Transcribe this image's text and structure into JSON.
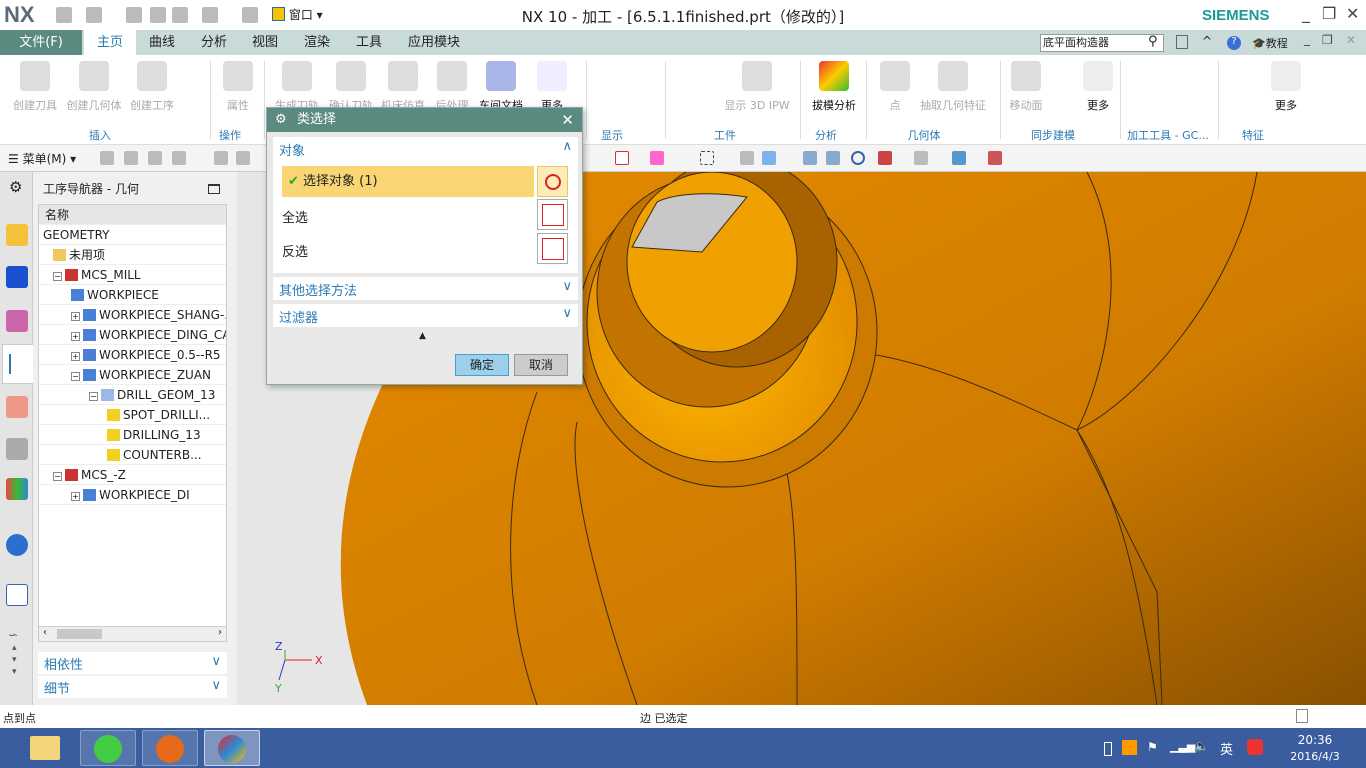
{
  "title_bar": {
    "logo": "NX",
    "window_title": "NX 10 - 加工 - [6.5.1.1finished.prt（修改的）]",
    "window_menu": "窗口",
    "brand": "SIEMENS"
  },
  "menu_tabs": {
    "file": "文件(F)",
    "tabs": [
      "主页",
      "曲线",
      "分析",
      "视图",
      "渲染",
      "工具",
      "应用模块"
    ],
    "active": "主页"
  },
  "search": {
    "value": "底平面构造器",
    "tutorial": "教程"
  },
  "ribbon": {
    "buttons": [
      {
        "label": "创建刀具",
        "enabled": false
      },
      {
        "label": "创建几何体",
        "enabled": false
      },
      {
        "label": "创建工序",
        "enabled": false
      },
      {
        "label": "属性",
        "enabled": false
      },
      {
        "label": "生成刀轨",
        "enabled": false
      },
      {
        "label": "确认刀轨",
        "enabled": false
      },
      {
        "label": "机床仿真",
        "enabled": false
      },
      {
        "label": "后处理",
        "enabled": false
      },
      {
        "label": "车间文档",
        "enabled": true
      },
      {
        "label": "更多",
        "enabled": true
      },
      {
        "label": "显示 3D IPW",
        "enabled": false
      },
      {
        "label": "拔模分析",
        "enabled": true
      },
      {
        "label": "点",
        "enabled": false
      },
      {
        "label": "抽取几何特征",
        "enabled": false
      },
      {
        "label": "移动面",
        "enabled": false
      },
      {
        "label": "更多",
        "enabled": true
      },
      {
        "label": "更多",
        "enabled": true
      }
    ],
    "groups": [
      "插入",
      "操作",
      "显示",
      "工件",
      "分析",
      "几何体",
      "同步建模",
      "加工工具 - GC...",
      "特征"
    ]
  },
  "toolbar": {
    "menu": "菜单(M)"
  },
  "navigator": {
    "title": "工序导航器 - 几何",
    "column": "名称",
    "rows": [
      {
        "label": "GEOMETRY",
        "depth": 0,
        "icon": "none",
        "expander": ""
      },
      {
        "label": "未用项",
        "depth": 1,
        "icon": "folder-icon",
        "expander": ""
      },
      {
        "label": "MCS_MILL",
        "depth": 1,
        "icon": "mcs-icon",
        "expander": "-"
      },
      {
        "label": "WORKPIECE",
        "depth": 2,
        "icon": "workpiece-icon",
        "expander": ""
      },
      {
        "label": "WORKPIECE_SHANG-...",
        "depth": 2,
        "icon": "workpiece-icon",
        "expander": "+"
      },
      {
        "label": "WORKPIECE_DING_CA",
        "depth": 2,
        "icon": "workpiece-icon",
        "expander": "+"
      },
      {
        "label": "WORKPIECE_0.5--R5",
        "depth": 2,
        "icon": "workpiece-icon",
        "expander": "+"
      },
      {
        "label": "WORKPIECE_ZUAN",
        "depth": 2,
        "icon": "workpiece-icon",
        "expander": "-"
      },
      {
        "label": "DRILL_GEOM_13",
        "depth": 3,
        "icon": "drill-geom-icon",
        "expander": "-"
      },
      {
        "label": "SPOT_DRILLI...",
        "depth": 4,
        "icon": "operation-warning-icon",
        "expander": ""
      },
      {
        "label": "DRILLING_13",
        "depth": 4,
        "icon": "operation-warning-icon",
        "expander": ""
      },
      {
        "label": "COUNTERB...",
        "depth": 4,
        "icon": "operation-warning-icon",
        "expander": ""
      },
      {
        "label": "MCS_-Z",
        "depth": 1,
        "icon": "mcs-icon",
        "expander": "-"
      },
      {
        "label": "WORKPIECE_DI",
        "depth": 2,
        "icon": "workpiece-icon",
        "expander": "+"
      }
    ],
    "panels": [
      "相依性",
      "细节"
    ]
  },
  "dialog": {
    "title": "类选择",
    "section_object": "对象",
    "select_object": "选择对象 (1)",
    "select_all": "全选",
    "invert": "反选",
    "other_methods": "其他选择方法",
    "filter": "过滤器",
    "ok": "确定",
    "cancel": "取消"
  },
  "triad": {
    "x": "X",
    "y": "Y",
    "z": "Z"
  },
  "status": {
    "left": "点到点",
    "center": "边 已选定"
  },
  "taskbar": {
    "time": "20:36",
    "date": "2016/4/3",
    "ime": "英"
  },
  "colors": {
    "accent": "#5a8a80",
    "part": "#d98200",
    "link": "#2a7ab5",
    "selected_row": "#f9d673",
    "taskbar": "#3a5d9f"
  }
}
